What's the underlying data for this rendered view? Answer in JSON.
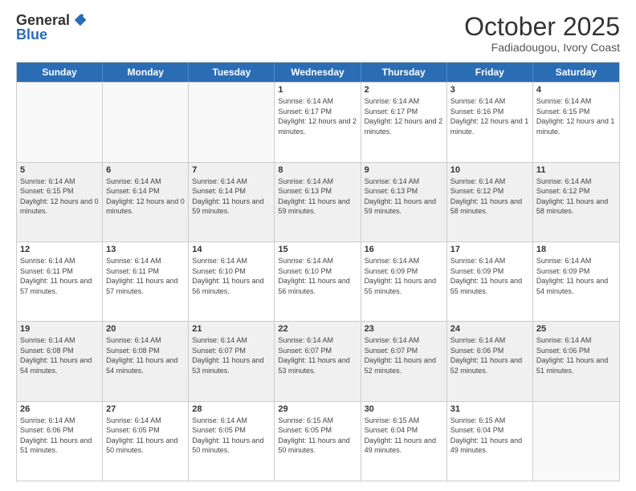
{
  "logo": {
    "general": "General",
    "blue": "Blue"
  },
  "header": {
    "month": "October 2025",
    "location": "Fadiadougou, Ivory Coast"
  },
  "days": [
    "Sunday",
    "Monday",
    "Tuesday",
    "Wednesday",
    "Thursday",
    "Friday",
    "Saturday"
  ],
  "rows": [
    [
      {
        "day": "",
        "sunrise": "",
        "sunset": "",
        "daylight": "",
        "empty": true
      },
      {
        "day": "",
        "sunrise": "",
        "sunset": "",
        "daylight": "",
        "empty": true
      },
      {
        "day": "",
        "sunrise": "",
        "sunset": "",
        "daylight": "",
        "empty": true
      },
      {
        "day": "1",
        "sunrise": "Sunrise: 6:14 AM",
        "sunset": "Sunset: 6:17 PM",
        "daylight": "Daylight: 12 hours and 2 minutes."
      },
      {
        "day": "2",
        "sunrise": "Sunrise: 6:14 AM",
        "sunset": "Sunset: 6:17 PM",
        "daylight": "Daylight: 12 hours and 2 minutes."
      },
      {
        "day": "3",
        "sunrise": "Sunrise: 6:14 AM",
        "sunset": "Sunset: 6:16 PM",
        "daylight": "Daylight: 12 hours and 1 minute."
      },
      {
        "day": "4",
        "sunrise": "Sunrise: 6:14 AM",
        "sunset": "Sunset: 6:15 PM",
        "daylight": "Daylight: 12 hours and 1 minute."
      }
    ],
    [
      {
        "day": "5",
        "sunrise": "Sunrise: 6:14 AM",
        "sunset": "Sunset: 6:15 PM",
        "daylight": "Daylight: 12 hours and 0 minutes."
      },
      {
        "day": "6",
        "sunrise": "Sunrise: 6:14 AM",
        "sunset": "Sunset: 6:14 PM",
        "daylight": "Daylight: 12 hours and 0 minutes."
      },
      {
        "day": "7",
        "sunrise": "Sunrise: 6:14 AM",
        "sunset": "Sunset: 6:14 PM",
        "daylight": "Daylight: 11 hours and 59 minutes."
      },
      {
        "day": "8",
        "sunrise": "Sunrise: 6:14 AM",
        "sunset": "Sunset: 6:13 PM",
        "daylight": "Daylight: 11 hours and 59 minutes."
      },
      {
        "day": "9",
        "sunrise": "Sunrise: 6:14 AM",
        "sunset": "Sunset: 6:13 PM",
        "daylight": "Daylight: 11 hours and 59 minutes."
      },
      {
        "day": "10",
        "sunrise": "Sunrise: 6:14 AM",
        "sunset": "Sunset: 6:12 PM",
        "daylight": "Daylight: 11 hours and 58 minutes."
      },
      {
        "day": "11",
        "sunrise": "Sunrise: 6:14 AM",
        "sunset": "Sunset: 6:12 PM",
        "daylight": "Daylight: 11 hours and 58 minutes."
      }
    ],
    [
      {
        "day": "12",
        "sunrise": "Sunrise: 6:14 AM",
        "sunset": "Sunset: 6:11 PM",
        "daylight": "Daylight: 11 hours and 57 minutes."
      },
      {
        "day": "13",
        "sunrise": "Sunrise: 6:14 AM",
        "sunset": "Sunset: 6:11 PM",
        "daylight": "Daylight: 11 hours and 57 minutes."
      },
      {
        "day": "14",
        "sunrise": "Sunrise: 6:14 AM",
        "sunset": "Sunset: 6:10 PM",
        "daylight": "Daylight: 11 hours and 56 minutes."
      },
      {
        "day": "15",
        "sunrise": "Sunrise: 6:14 AM",
        "sunset": "Sunset: 6:10 PM",
        "daylight": "Daylight: 11 hours and 56 minutes."
      },
      {
        "day": "16",
        "sunrise": "Sunrise: 6:14 AM",
        "sunset": "Sunset: 6:09 PM",
        "daylight": "Daylight: 11 hours and 55 minutes."
      },
      {
        "day": "17",
        "sunrise": "Sunrise: 6:14 AM",
        "sunset": "Sunset: 6:09 PM",
        "daylight": "Daylight: 11 hours and 55 minutes."
      },
      {
        "day": "18",
        "sunrise": "Sunrise: 6:14 AM",
        "sunset": "Sunset: 6:09 PM",
        "daylight": "Daylight: 11 hours and 54 minutes."
      }
    ],
    [
      {
        "day": "19",
        "sunrise": "Sunrise: 6:14 AM",
        "sunset": "Sunset: 6:08 PM",
        "daylight": "Daylight: 11 hours and 54 minutes."
      },
      {
        "day": "20",
        "sunrise": "Sunrise: 6:14 AM",
        "sunset": "Sunset: 6:08 PM",
        "daylight": "Daylight: 11 hours and 54 minutes."
      },
      {
        "day": "21",
        "sunrise": "Sunrise: 6:14 AM",
        "sunset": "Sunset: 6:07 PM",
        "daylight": "Daylight: 11 hours and 53 minutes."
      },
      {
        "day": "22",
        "sunrise": "Sunrise: 6:14 AM",
        "sunset": "Sunset: 6:07 PM",
        "daylight": "Daylight: 11 hours and 53 minutes."
      },
      {
        "day": "23",
        "sunrise": "Sunrise: 6:14 AM",
        "sunset": "Sunset: 6:07 PM",
        "daylight": "Daylight: 11 hours and 52 minutes."
      },
      {
        "day": "24",
        "sunrise": "Sunrise: 6:14 AM",
        "sunset": "Sunset: 6:06 PM",
        "daylight": "Daylight: 11 hours and 52 minutes."
      },
      {
        "day": "25",
        "sunrise": "Sunrise: 6:14 AM",
        "sunset": "Sunset: 6:06 PM",
        "daylight": "Daylight: 11 hours and 51 minutes."
      }
    ],
    [
      {
        "day": "26",
        "sunrise": "Sunrise: 6:14 AM",
        "sunset": "Sunset: 6:06 PM",
        "daylight": "Daylight: 11 hours and 51 minutes."
      },
      {
        "day": "27",
        "sunrise": "Sunrise: 6:14 AM",
        "sunset": "Sunset: 6:05 PM",
        "daylight": "Daylight: 11 hours and 50 minutes."
      },
      {
        "day": "28",
        "sunrise": "Sunrise: 6:14 AM",
        "sunset": "Sunset: 6:05 PM",
        "daylight": "Daylight: 11 hours and 50 minutes."
      },
      {
        "day": "29",
        "sunrise": "Sunrise: 6:15 AM",
        "sunset": "Sunset: 6:05 PM",
        "daylight": "Daylight: 11 hours and 50 minutes."
      },
      {
        "day": "30",
        "sunrise": "Sunrise: 6:15 AM",
        "sunset": "Sunset: 6:04 PM",
        "daylight": "Daylight: 11 hours and 49 minutes."
      },
      {
        "day": "31",
        "sunrise": "Sunrise: 6:15 AM",
        "sunset": "Sunset: 6:04 PM",
        "daylight": "Daylight: 11 hours and 49 minutes."
      },
      {
        "day": "",
        "sunrise": "",
        "sunset": "",
        "daylight": "",
        "empty": true
      }
    ]
  ]
}
